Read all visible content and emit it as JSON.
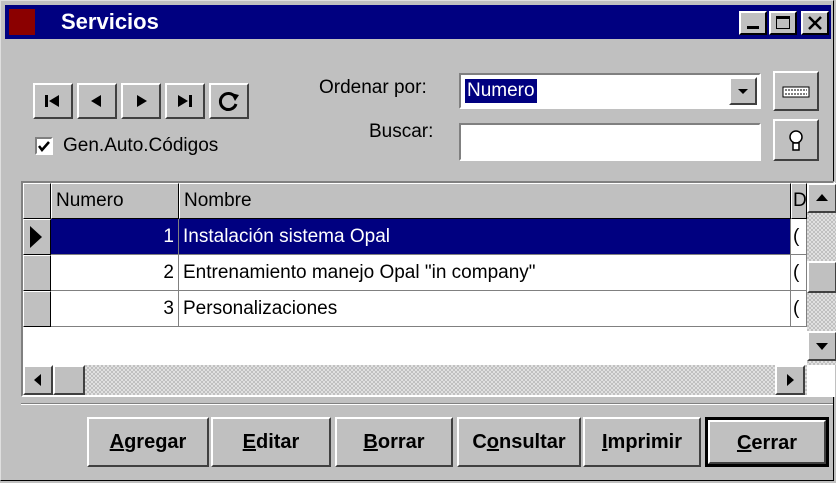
{
  "window": {
    "title": "Servicios"
  },
  "toolbar": {
    "ordenar_label": "Ordenar por:",
    "ordenar_value": "Numero",
    "buscar_label": "Buscar:",
    "buscar_value": "",
    "gen_auto_label": "Gen.Auto.Códigos",
    "gen_auto_checked": true
  },
  "grid": {
    "columns": [
      "Numero",
      "Nombre",
      "D"
    ],
    "rows": [
      {
        "numero": "1",
        "nombre": "Instalación sistema Opal",
        "d": "(",
        "selected": true
      },
      {
        "numero": "2",
        "nombre": "Entrenamiento manejo Opal \"in company\"",
        "d": "(",
        "selected": false
      },
      {
        "numero": "3",
        "nombre": "Personalizaciones",
        "d": "(",
        "selected": false
      }
    ]
  },
  "buttons": {
    "agregar": {
      "u": "A",
      "rest": "gregar"
    },
    "editar": {
      "u": "E",
      "rest": "ditar"
    },
    "borrar": {
      "u": "B",
      "rest": "orrar"
    },
    "consultar": {
      "pre": "C",
      "u": "o",
      "rest": "nsultar"
    },
    "imprimir": {
      "u": "I",
      "rest": "mprimir"
    },
    "cerrar": {
      "u": "C",
      "rest": "errar"
    }
  }
}
